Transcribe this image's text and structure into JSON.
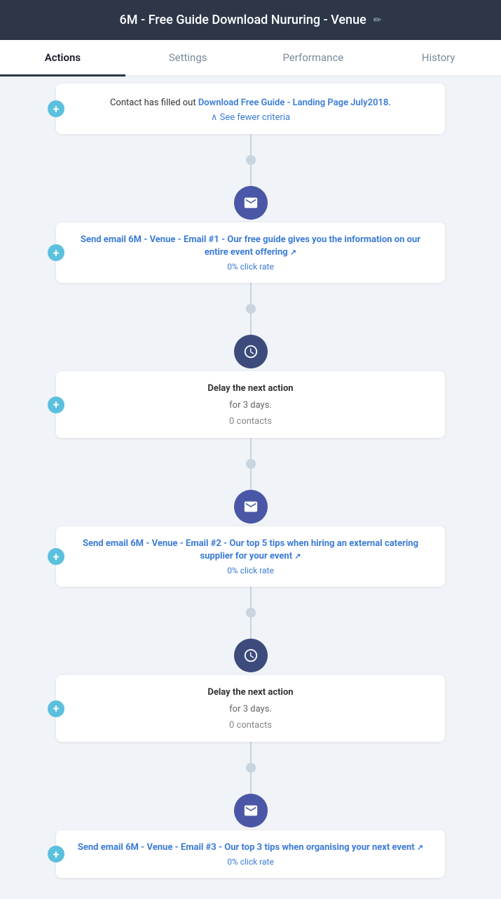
{
  "header": {
    "title": "6M - Free Guide Download Nururing - Venue",
    "edit_icon": "✏"
  },
  "tabs": [
    {
      "label": "Actions",
      "active": true
    },
    {
      "label": "Settings",
      "active": false
    },
    {
      "label": "Performance",
      "active": false
    },
    {
      "label": "History",
      "active": false
    }
  ],
  "trigger_card": {
    "body": "Contact has filled out",
    "link_text": "Download Free Guide - Landing Page July2018.",
    "see_fewer": "∧ See fewer criteria"
  },
  "steps": [
    {
      "type": "email",
      "title": "Send email 6M - Venue - Email #1 - Our free guide gives you the information on our entire event offering",
      "stat": "0% click rate",
      "has_link_icon": true
    },
    {
      "type": "delay",
      "title": "Delay the next action",
      "sub": "for 3 days.",
      "contacts": "0 contacts"
    },
    {
      "type": "email",
      "title": "Send email 6M - Venue - Email #2 - Our top 5 tips when hiring an external catering supplier for your event",
      "stat": "0% click rate",
      "has_link_icon": true
    },
    {
      "type": "delay",
      "title": "Delay the next action",
      "sub": "for 3 days.",
      "contacts": "0 contacts"
    },
    {
      "type": "email",
      "title": "Send email 6M - Venue - Email #3 - Our top 3 tips when organising your next event",
      "stat": "0% click rate",
      "has_link_icon": true
    }
  ]
}
